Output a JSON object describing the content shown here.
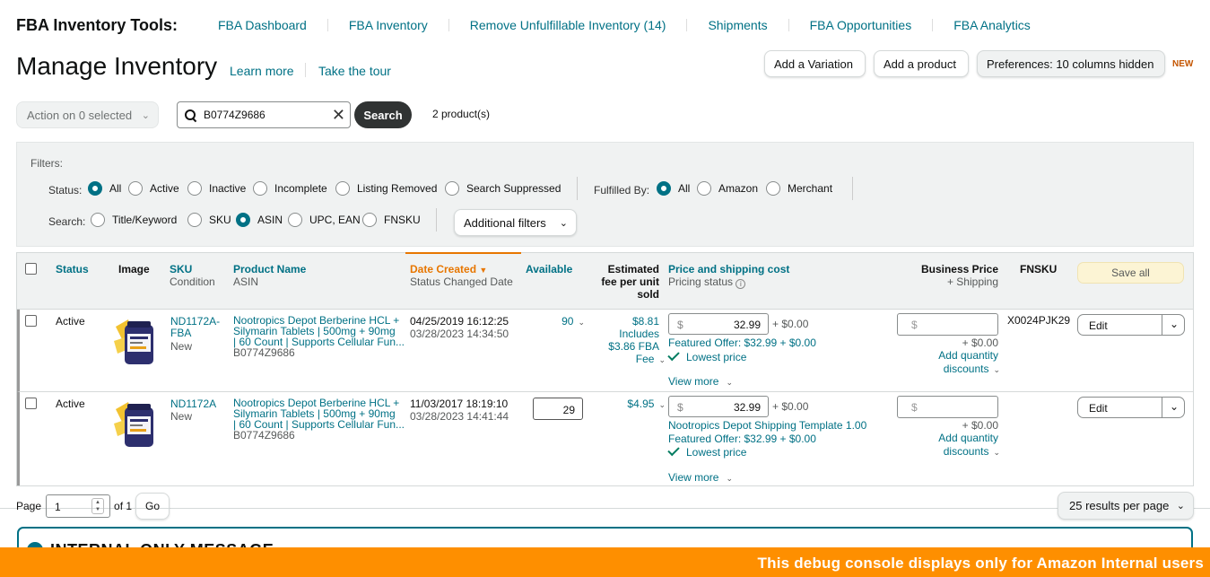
{
  "nav": {
    "brand": "FBA Inventory Tools:",
    "links": [
      "FBA Dashboard",
      "FBA Inventory",
      "Remove Unfulfillable Inventory (14)",
      "Shipments",
      "FBA Opportunities",
      "FBA Analytics"
    ]
  },
  "header": {
    "title": "Manage Inventory",
    "learn_more": "Learn more",
    "take_tour": "Take the tour",
    "add_variation": "Add a Variation",
    "add_product": "Add a product",
    "preferences": "Preferences: 10 columns hidden",
    "new_badge": "NEW"
  },
  "search": {
    "action_label": "Action on 0 selected",
    "query": "B0774Z9686",
    "button": "Search",
    "result_count": "2 product(s)"
  },
  "filters": {
    "title": "Filters:",
    "status_label": "Status:",
    "status_options": [
      "All",
      "Active",
      "Inactive",
      "Incomplete",
      "Listing Removed",
      "Search Suppressed"
    ],
    "fulfilled_label": "Fulfilled By:",
    "fulfilled_options": [
      "All",
      "Amazon",
      "Merchant"
    ],
    "search_label": "Search:",
    "search_options": [
      "Title/Keyword",
      "SKU",
      "ASIN",
      "UPC, EAN",
      "FNSKU"
    ],
    "additional": "Additional filters"
  },
  "table": {
    "headers": {
      "status": "Status",
      "image": "Image",
      "sku": "SKU",
      "sku_sub": "Condition",
      "name": "Product Name",
      "name_sub": "ASIN",
      "date": "Date Created",
      "date_sub": "Status Changed Date",
      "available": "Available",
      "fee1": "Estimated",
      "fee2": "fee per unit",
      "fee3": "sold",
      "price": "Price and shipping cost",
      "price_sub": "Pricing status",
      "business": "Business Price",
      "business_sub": "+ Shipping",
      "fnsku": "FNSKU",
      "save_all": "Save all"
    },
    "rows": [
      {
        "status": "Active",
        "sku1": "ND1172A-",
        "sku2": "FBA",
        "condition": "New",
        "name1": "Nootropics Depot Berberine HCL +",
        "name2": "Silymarin Tablets | 500mg + 90mg",
        "name3": "| 60 Count | Supports Cellular Fun...",
        "asin": "B0774Z9686",
        "created": "04/25/2019 16:12:25",
        "changed": "03/28/2023 14:34:50",
        "available": "90",
        "fee": "$8.81",
        "fee_inc1": "Includes",
        "fee_inc2": "$3.86 FBA",
        "fee_inc3": "Fee",
        "currency": "$",
        "price": "32.99",
        "shipping": "+ $0.00",
        "featured": "Featured Offer: $32.99 + $0.00",
        "lowest": "Lowest price",
        "view_more": "View more",
        "bp_currency": "$",
        "bp_shipping": "+ $0.00",
        "qty1": "Add quantity",
        "qty2": "discounts",
        "fnsku": "X0024PJK29",
        "edit": "Edit"
      },
      {
        "status": "Active",
        "sku1": "ND1172A",
        "condition": "New",
        "name1": "Nootropics Depot Berberine HCL +",
        "name2": "Silymarin Tablets | 500mg + 90mg",
        "name3": "| 60 Count | Supports Cellular Fun...",
        "asin": "B0774Z9686",
        "created": "11/03/2017 18:19:10",
        "changed": "03/28/2023 14:41:44",
        "available": "29",
        "fee": "$4.95",
        "currency": "$",
        "price": "32.99",
        "shipping": "+ $0.00",
        "template": "Nootropics Depot Shipping Template 1.00",
        "featured": "Featured Offer: $32.99 + $0.00",
        "lowest": "Lowest price",
        "view_more": "View more",
        "bp_currency": "$",
        "bp_shipping": "+ $0.00",
        "qty1": "Add quantity",
        "qty2": "discounts",
        "edit": "Edit"
      }
    ]
  },
  "pager": {
    "page_label": "Page",
    "page_value": "1",
    "of": "of 1",
    "go": "Go",
    "per_page": "25 results per page"
  },
  "internal": {
    "message": "INTERNAL ONLY MESSAGE",
    "debug": "This debug console displays only for Amazon Internal users"
  },
  "colors": {
    "link": "#007185",
    "sort_accent": "#e77600",
    "debug_bar": "#fe8f00"
  }
}
